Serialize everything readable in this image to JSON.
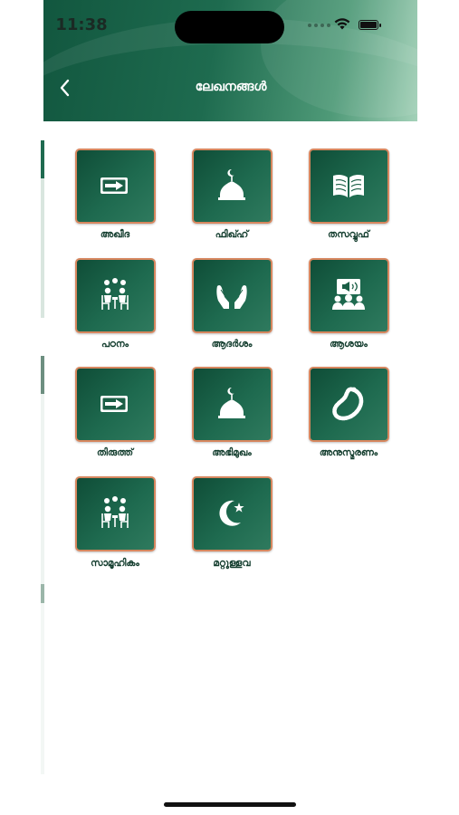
{
  "status_bar": {
    "time": "11:38"
  },
  "header": {
    "title": "ലേഖനങ്ങൾ"
  },
  "categories": [
    {
      "label": "അഖീദ",
      "icon": "arrow-right-icon"
    },
    {
      "label": "ഫിഖ്ഹ്",
      "icon": "mosque-dome-icon"
    },
    {
      "label": "തസവ്വുഫ്",
      "icon": "open-book-icon"
    },
    {
      "label": "പഠനം",
      "icon": "discussion-icon"
    },
    {
      "label": "ആദർശം",
      "icon": "praying-hands-icon"
    },
    {
      "label": "ആശയം",
      "icon": "presentation-icon"
    },
    {
      "label": "തിരുത്ത്",
      "icon": "arrow-right-icon"
    },
    {
      "label": "അഭിമുഖം",
      "icon": "mosque-dome-icon"
    },
    {
      "label": "അനുസ്മരണം",
      "icon": "prayer-beads-icon"
    },
    {
      "label": "സാമൂഹികം",
      "icon": "discussion-icon"
    },
    {
      "label": "മറ്റുള്ളവ",
      "icon": "crescent-star-icon"
    }
  ],
  "colors": {
    "header_dark": "#12573f",
    "tile_green": "#1e6a4f",
    "tile_border": "#d7875f"
  }
}
